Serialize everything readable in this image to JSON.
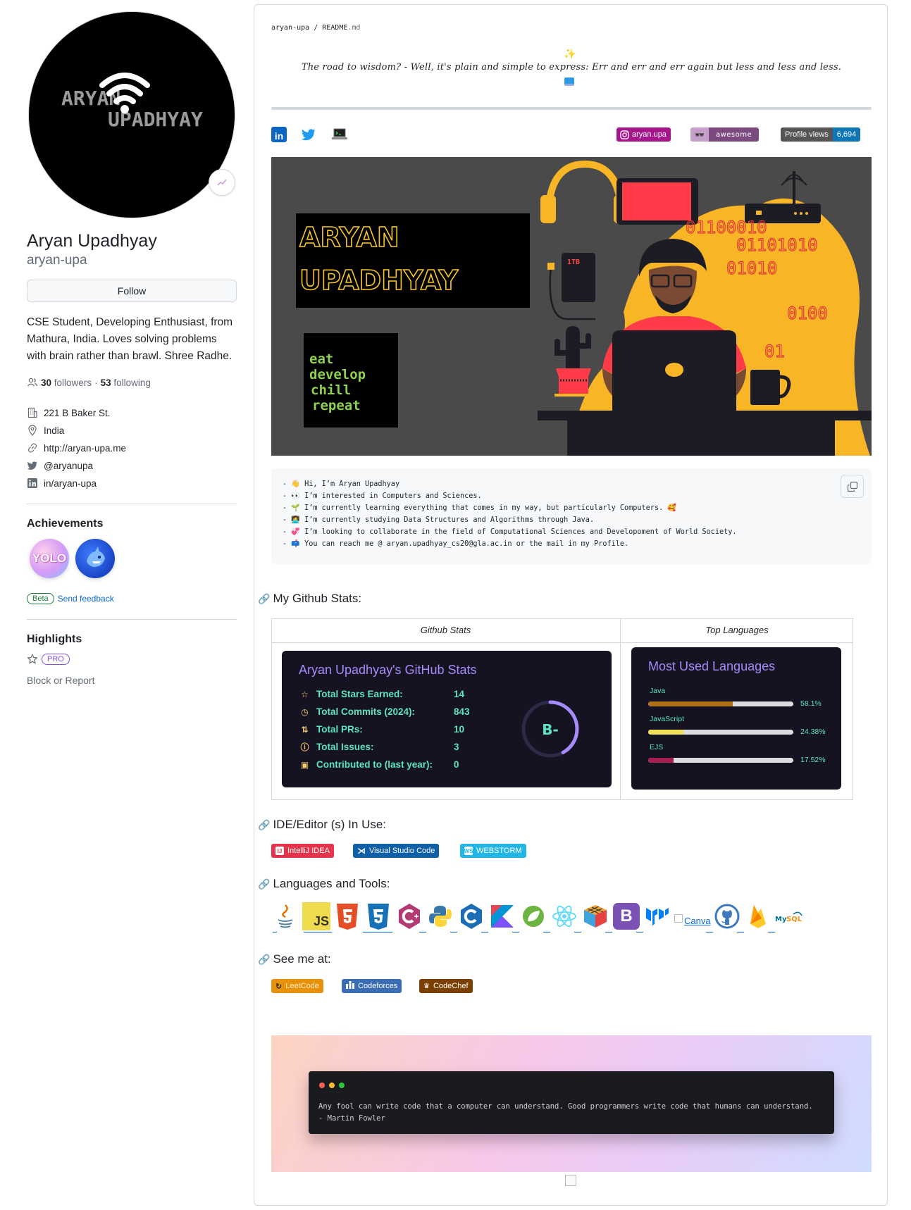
{
  "profile": {
    "name": "Aryan Upadhyay",
    "login": "aryan-upa",
    "follow_label": "Follow",
    "bio": "CSE Student, Developing Enthusiast, from Mathura, India. Loves solving problems with brain rather than brawl. Shree Radhe.",
    "followers_count": "30",
    "followers_label": "followers",
    "separator": "·",
    "following_count": "53",
    "following_label": "following",
    "company": "221 B Baker St.",
    "location": "India",
    "website": "http://aryan-upa.me",
    "twitter": "@aryanupa",
    "linkedin": "in/aryan-upa",
    "avatar_text_1": "ARYAN",
    "avatar_text_2": "UPADHYAY"
  },
  "achievements": {
    "heading": "Achievements",
    "badge_1": "YOLO",
    "beta_label": "Beta",
    "feedback_label": "Send feedback"
  },
  "highlights": {
    "heading": "Highlights",
    "pro_label": "PRO",
    "block_label": "Block or Report"
  },
  "readme": {
    "breadcrumb_user": "aryan-upa",
    "breadcrumb_sep": " / ",
    "breadcrumb_file": "README",
    "breadcrumb_ext": ".md",
    "quote": "The road to wisdom? - Well, it's plain and simple to express: Err and err and err again but less and less and less.",
    "badges": {
      "instagram": "aryan.upa",
      "awesome": "awesome",
      "views_label": "Profile views",
      "views_count": "6,694"
    },
    "banner": {
      "title_1": "ARYAN",
      "title_2": "UPADHYAY",
      "motto": [
        "eat",
        "develop",
        "chill",
        "repeat"
      ],
      "drive_label": "1TB",
      "binary": [
        "01100010",
        "01101010",
        "01010",
        "0100",
        "01"
      ]
    },
    "intro_lines": [
      {
        "emoji": "👋",
        "text": "Hi, I’m Aryan Upadhyay"
      },
      {
        "emoji": "👀",
        "text": "I’m interested in Computers and Sciences."
      },
      {
        "emoji": "🌱",
        "text": "I’m currently learning everything that comes in my way, but particularly Computers. 🥰"
      },
      {
        "emoji": "👩‍💻",
        "text": "I’m currently studying Data Structures and Algorithms through Java."
      },
      {
        "emoji": "💞️",
        "text": "I’m looking to collaborate in the field of Computational Sciences and Developoment of World Society."
      },
      {
        "emoji": "📫",
        "text": "You can reach me @ aryan.upadhyay_cs20@gla.ac.in or the mail in my Profile."
      }
    ],
    "stats_heading": "My Github Stats:",
    "stats_col_1": "Github Stats",
    "stats_col_2": "Top Languages",
    "gh_stats": {
      "title": "Aryan Upadhyay's GitHub Stats",
      "rows": [
        {
          "label": "Total Stars Earned:",
          "value": "14"
        },
        {
          "label": "Total Commits (2024):",
          "value": "843"
        },
        {
          "label": "Total PRs:",
          "value": "10"
        },
        {
          "label": "Total Issues:",
          "value": "3"
        },
        {
          "label": "Contributed to (last year):",
          "value": "0"
        }
      ],
      "rank": "B-",
      "rank_fill": 0.42
    },
    "languages": {
      "title": "Most Used Languages",
      "items": [
        {
          "name": "Java",
          "percent": "58.1%",
          "fill": 0.581,
          "color": "#b07219"
        },
        {
          "name": "JavaScript",
          "percent": "24.38%",
          "fill": 0.2438,
          "color": "#f1e05a"
        },
        {
          "name": "EJS",
          "percent": "17.52%",
          "fill": 0.1752,
          "color": "#a91e50"
        }
      ]
    },
    "ide_heading": "IDE/Editor (s) In Use:",
    "ides": [
      "IntelliJ IDEA",
      "Visual Studio Code",
      "WEBSTORM"
    ],
    "tools_heading": "Languages and Tools:",
    "tools": [
      "java",
      "javascript",
      "html5",
      "css3",
      "cplusplus",
      "python",
      "c",
      "kotlin",
      "spring",
      "react",
      "rubiks-cube",
      "bootstrap",
      "material-ui",
      "Canva",
      "github",
      "firebase",
      "mysql"
    ],
    "canva_alt": "Canva",
    "see_heading": "See me at:",
    "see_links": [
      "LeetCode",
      "Codeforces",
      "CodeChef"
    ],
    "footer_quote": "Any fool can write code that a computer can understand. Good programmers write code that humans can understand.",
    "footer_author": "- Martin Fowler"
  },
  "colors": {
    "link": "#0969da",
    "accent_purple": "#a78bfa",
    "stats_teal": "#5ce4c3",
    "card_bg": "#151321"
  }
}
